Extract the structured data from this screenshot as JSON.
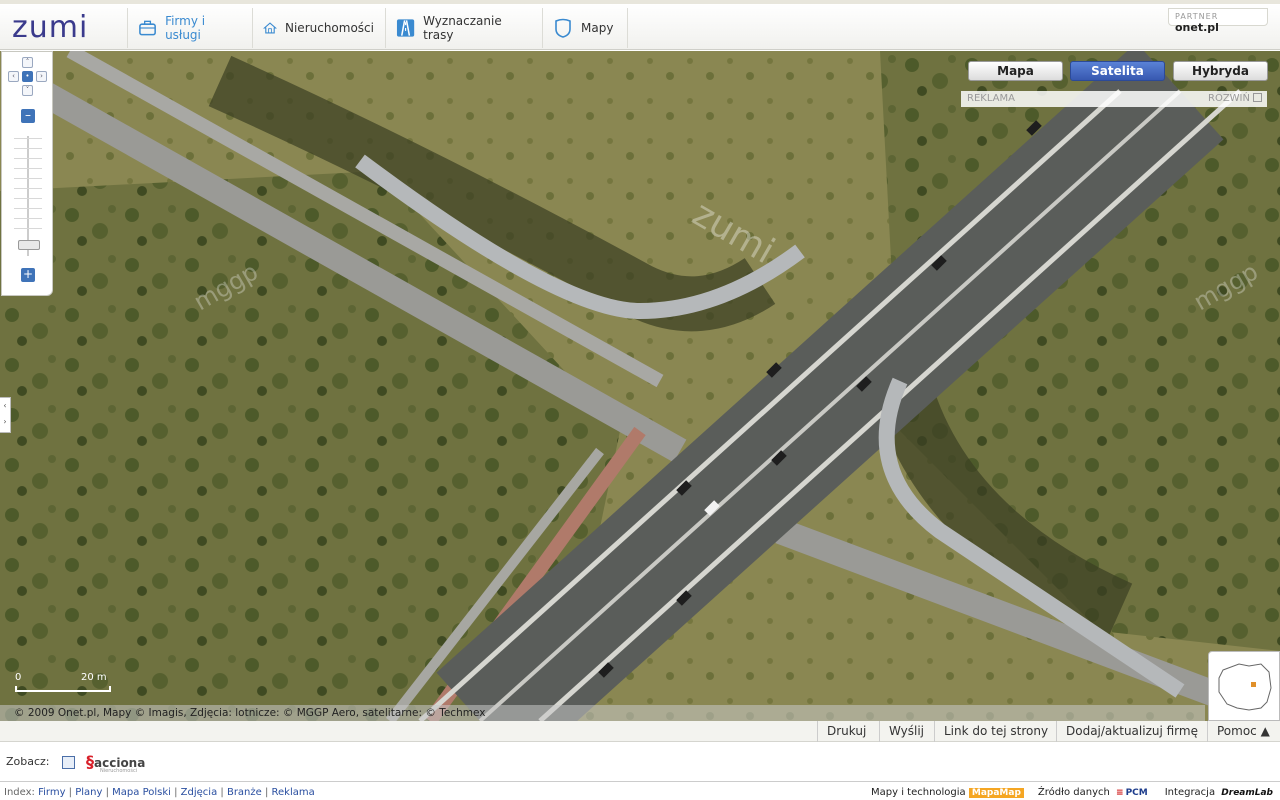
{
  "header": {
    "logo": "zumi",
    "tabs": [
      {
        "label": "Firmy i usługi",
        "active": true
      },
      {
        "label": "Nieruchomości",
        "active": false
      },
      {
        "label": "Wyznaczanie trasy",
        "active": false
      },
      {
        "label": "Mapy",
        "active": false
      }
    ],
    "partner_label": "PARTNER",
    "partner_brand": "onet.pl"
  },
  "map": {
    "types": [
      "Mapa",
      "Satelita",
      "Hybryda"
    ],
    "active_type": "Satelita",
    "ad_label": "REKLAMA",
    "ad_expand": "ROZWIŃ",
    "scale_start": "0",
    "scale_end": "20 m",
    "copyright": "© 2009 Onet.pl, Mapy © Imagis, Zdjęcia: lotnicze: © MGGP Aero, satelitarne: © Techmex",
    "watermarks": [
      "zumi",
      "mggp",
      "mggp"
    ]
  },
  "toolbar": {
    "buttons": [
      "Drukuj",
      "Wyślij",
      "Link do tej strony",
      "Dodaj/aktualizuj firmę",
      "Pomoc ▲"
    ]
  },
  "see_also": {
    "label": "Zobacz:",
    "brand": "acciona",
    "brand_sub": "Nieruchomości"
  },
  "footer": {
    "index_label": "Index:",
    "links": [
      "Firmy",
      "Plany",
      "Mapa Polski",
      "Zdjęcia",
      "Branże",
      "Reklama"
    ],
    "maps_tech_label": "Mapy i technologia",
    "maps_tech_brand": "MapaMap",
    "data_source_label": "Źródło danych",
    "data_source_brand": "PCM",
    "integration_label": "Integracja",
    "integration_brand": "DreamLab"
  },
  "colors": {
    "accent": "#3a8ad0",
    "active_maptype": "#3758b0",
    "zoom_button": "#3f73b8"
  }
}
